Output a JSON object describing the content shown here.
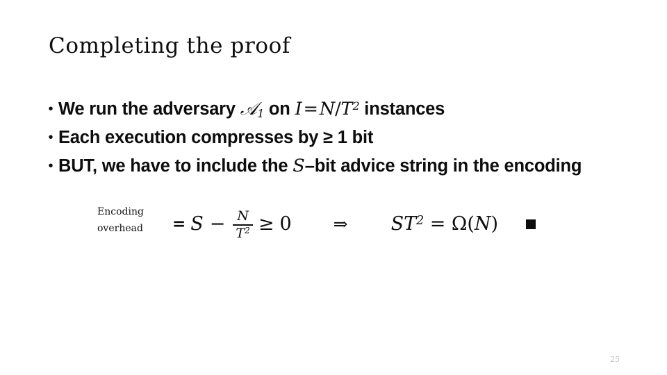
{
  "slide": {
    "title": "Completing the proof",
    "page_number": "25",
    "background_color": "#ffffff",
    "text_color": "#0d0d0d",
    "page_number_color": "#bdbdbd"
  },
  "bullets": [
    {
      "marker": "•",
      "plain_text": "We run the adversary 𝒜₁ on I = N/T² instances",
      "parts": {
        "lead": "We run the adversary ",
        "script_a": "𝒜",
        "script_a_sub": "1",
        "mid": " on ",
        "var_i": "I",
        "equals": "=",
        "var_n": "N",
        "slash": "/",
        "var_t": "T",
        "t_exponent": "2",
        "tail": " instances"
      }
    },
    {
      "marker": "•",
      "plain_text": "Each execution compresses by ≥ 1 bit",
      "parts": {
        "lead": "Each execution compresses by ≥ 1 bit"
      }
    },
    {
      "marker": "•",
      "plain_text": "BUT, we have to include the S-bit advice string in the encoding",
      "parts": {
        "lead": "BUT, we have to include the ",
        "var_s": "S",
        "tail": "–bit advice string in the encoding"
      }
    }
  ],
  "equation": {
    "annotation_line1": "Encoding",
    "annotation_line2": "overhead",
    "equals_sign": "=",
    "var_s": "S",
    "minus": "−",
    "fraction_numerator": "N",
    "fraction_denominator": "T",
    "fraction_denominator_exponent": "2",
    "geq": "≥",
    "zero": "0",
    "implies": "⇒",
    "result_s": "S",
    "result_t": "T",
    "result_t_exponent": "2",
    "result_equals": "=",
    "result_omega": "Ω",
    "result_open_paren": "(",
    "result_n": "N",
    "result_close_paren": ")",
    "qed_symbol": "■",
    "plain_text": "= S − N/T² ≥ 0  ⇒  ST² = Ω(N) ■"
  }
}
